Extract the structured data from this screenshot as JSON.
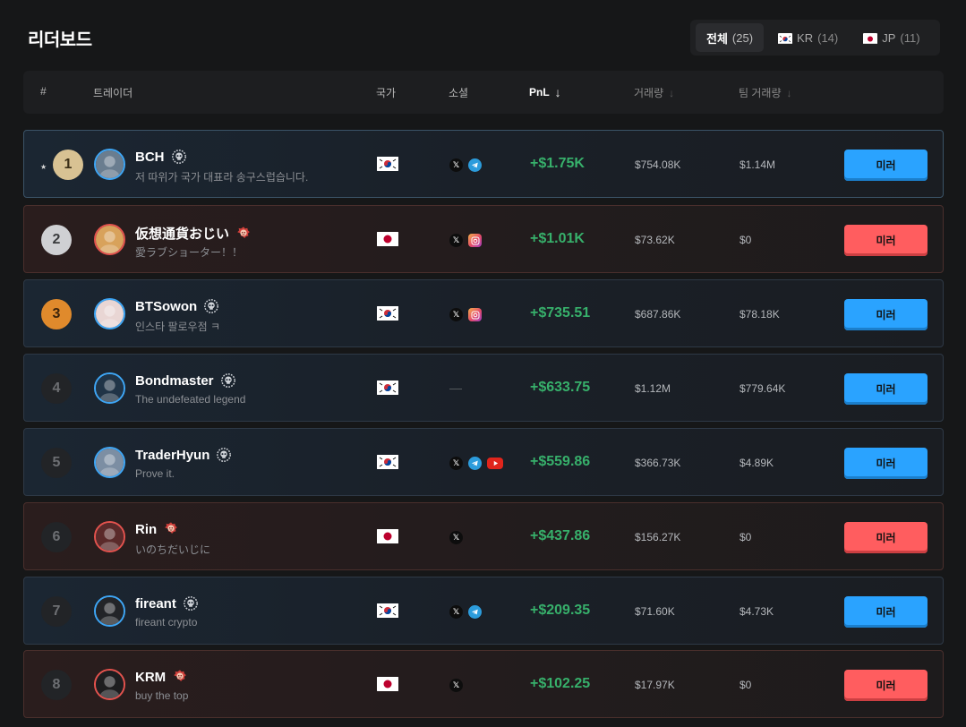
{
  "page": {
    "title": "리더보드"
  },
  "filters": [
    {
      "label": "전체",
      "count": "(25)",
      "flag": "",
      "active": true
    },
    {
      "label": "KR",
      "count": "(14)",
      "flag": "kr",
      "active": false
    },
    {
      "label": "JP",
      "count": "(11)",
      "flag": "jp",
      "active": false
    }
  ],
  "columns": {
    "rank": "#",
    "trader": "트레이더",
    "country": "국가",
    "social": "소셜",
    "pnl": "PnL",
    "volume": "거래량",
    "team_volume": "팀 거래량",
    "sort_arrow": "↓"
  },
  "mirror_label": "미러",
  "rows": [
    {
      "rank": "1",
      "name": "BCH",
      "bio": "저 따위가 국가 대표라 송구스럽습니다.",
      "country": "kr",
      "socials": [
        "x",
        "telegram"
      ],
      "pnl": "+$1.75K",
      "volume": "$754.08K",
      "team_volume": "$1.14M",
      "star": "★"
    },
    {
      "rank": "2",
      "name": "仮想通貨おじい",
      "bio": "愛ラブショーター！！",
      "country": "jp",
      "socials": [
        "x",
        "instagram"
      ],
      "pnl": "+$1.01K",
      "volume": "$73.62K",
      "team_volume": "$0"
    },
    {
      "rank": "3",
      "name": "BTSowon",
      "bio": "인스타 팔로우점 ㅋ",
      "country": "kr",
      "socials": [
        "x",
        "instagram"
      ],
      "pnl": "+$735.51",
      "volume": "$687.86K",
      "team_volume": "$78.18K"
    },
    {
      "rank": "4",
      "name": "Bondmaster",
      "bio": "The undefeated legend",
      "country": "kr",
      "socials": [],
      "social_empty": "—",
      "pnl": "+$633.75",
      "volume": "$1.12M",
      "team_volume": "$779.64K"
    },
    {
      "rank": "5",
      "name": "TraderHyun",
      "bio": "Prove it.",
      "country": "kr",
      "socials": [
        "x",
        "telegram",
        "youtube"
      ],
      "pnl": "+$559.86",
      "volume": "$366.73K",
      "team_volume": "$4.89K"
    },
    {
      "rank": "6",
      "name": "Rin",
      "bio": "いのちだいじに",
      "country": "jp",
      "socials": [
        "x"
      ],
      "pnl": "+$437.86",
      "volume": "$156.27K",
      "team_volume": "$0"
    },
    {
      "rank": "7",
      "name": "fireant",
      "bio": "fireant crypto",
      "country": "kr",
      "socials": [
        "x",
        "telegram"
      ],
      "pnl": "+$209.35",
      "volume": "$71.60K",
      "team_volume": "$4.73K"
    },
    {
      "rank": "8",
      "name": "KRM",
      "bio": "buy the top",
      "country": "jp",
      "socials": [
        "x"
      ],
      "pnl": "+$102.25",
      "volume": "$17.97K",
      "team_volume": "$0"
    }
  ],
  "colors": {
    "pnl_positive": "#37b06b",
    "kr_accent": "#2aa3ff",
    "jp_accent": "#ff5d5f",
    "gold": "#d8c293",
    "silver": "#cfd0d3",
    "bronze": "#e08a2c"
  },
  "icons": {
    "kr_tier": "skull-badge-icon",
    "jp_tier": "red-mask-badge-icon",
    "sort": "arrow-down-icon"
  }
}
